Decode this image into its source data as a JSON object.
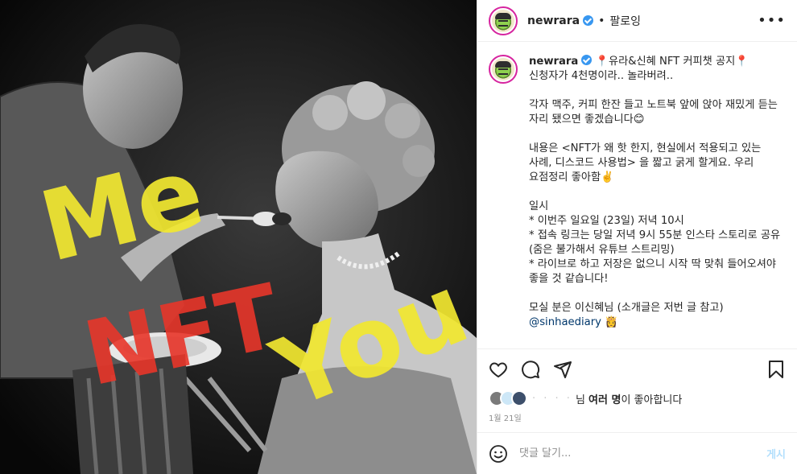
{
  "photo": {
    "overlay_words": [
      "Me",
      "NFT",
      "You"
    ],
    "overlay_colors": {
      "yellow": "#f2e830",
      "red": "#e8362a"
    }
  },
  "header": {
    "username": "newrara",
    "separator": "•",
    "follow_label": "팔로잉",
    "more_icon": "more-horizontal-icon"
  },
  "caption": {
    "username": "newrara",
    "text_1": "📍유라&신혜 NFT 커피챗 공지📍\n신청자가 4천명이라.. 놀라버려..\n\n각자 맥주, 커피 한잔 들고 노트북 앞에 앉아 재밌게 듣는 자리 됐으면 좋겠습니다😊\n\n내용은 <NFT가 왜 핫 한지, 현실에서 적용되고 있는 사례, 디스코드 사용법> 을 짧고 굵게 할게요. 우리 요점정리 좋아함✌️\n\n일시\n* 이번주 일요일 (23일) 저녁 10시\n* 접속 링크는 당일 저녁 9시 55분 인스타 스토리로 공유 (줌은 불가해서 유튜브 스트리밍)\n* 라이브로 하고 저장은 없으니 시작 딱 맞춰 들어오셔야 좋을 것 같습니다!\n\n모실 분은 이신혜님 (소개글은 저번 글 참고)\n",
    "mention": "@sinhaediary",
    "mention_suffix": " 👸"
  },
  "actions": {
    "like_icon": "heart-icon",
    "comment_icon": "comment-icon",
    "share_icon": "share-icon",
    "save_icon": "bookmark-icon"
  },
  "likes": {
    "blurred_name": "·  ·  ·  ·",
    "suffix_name": "님",
    "bold_text": "여러 명",
    "tail_text": "이 좋아합니다"
  },
  "date": "1월 21일",
  "comment_box": {
    "placeholder": "댓글 달기...",
    "post_label": "게시",
    "emoji_icon": "smile-icon"
  },
  "colors": {
    "link_blue": "#00376b",
    "verified_blue": "#3897f0",
    "post_disabled": "#b2dffc",
    "muted": "#8e8e8e"
  }
}
